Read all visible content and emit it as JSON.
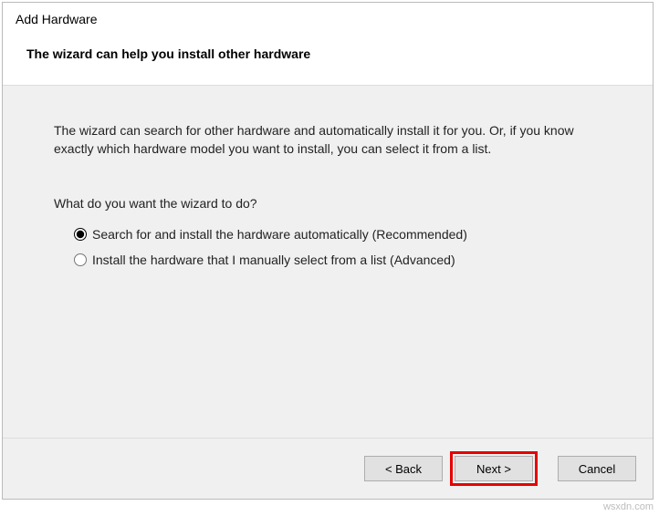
{
  "dialog": {
    "title": "Add Hardware",
    "subtitle": "The wizard can help you install other hardware"
  },
  "content": {
    "description": "The wizard can search for other hardware and automatically install it for you. Or, if you know exactly which hardware model you want to install, you can select it from a list.",
    "question": "What do you want the wizard to do?",
    "options": {
      "auto": "Search for and install the hardware automatically (Recommended)",
      "manual": "Install the hardware that I manually select from a list (Advanced)"
    }
  },
  "buttons": {
    "back": "< Back",
    "next": "Next >",
    "cancel": "Cancel"
  },
  "watermark": "wsxdn.com"
}
